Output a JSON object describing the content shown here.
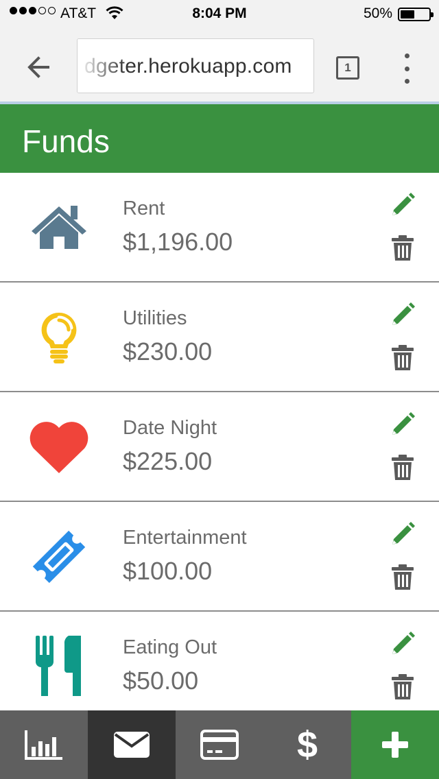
{
  "status_bar": {
    "carrier": "AT&T",
    "time": "8:04 PM",
    "battery_percent": "50%",
    "battery_level": 0.5,
    "signal_bars_filled": 3,
    "signal_bars_total": 5
  },
  "browser": {
    "url": "dgeter.herokuapp.com",
    "tab_count": "1"
  },
  "header": {
    "title": "Funds",
    "color": "#3a9140"
  },
  "funds": [
    {
      "name": "Rent",
      "amount": "$1,196.00",
      "icon": "house-icon",
      "icon_color": "#5a7a8f"
    },
    {
      "name": "Utilities",
      "amount": "$230.00",
      "icon": "lightbulb-icon",
      "icon_color": "#f5c218"
    },
    {
      "name": "Date Night",
      "amount": "$225.00",
      "icon": "heart-icon",
      "icon_color": "#f0443a"
    },
    {
      "name": "Entertainment",
      "amount": "$100.00",
      "icon": "ticket-icon",
      "icon_color": "#2a8ee8"
    },
    {
      "name": "Eating Out",
      "amount": "$50.00",
      "icon": "fork-knife-icon",
      "icon_color": "#0f9988"
    }
  ],
  "actions": {
    "edit_color": "#3a9140",
    "delete_color": "#5a5a5a"
  },
  "bottom_nav": [
    {
      "icon": "bar-chart-icon",
      "active": false
    },
    {
      "icon": "envelope-icon",
      "active": true
    },
    {
      "icon": "credit-card-icon",
      "active": false
    },
    {
      "icon": "dollar-icon",
      "label": "$",
      "active": false
    },
    {
      "icon": "plus-icon",
      "active": false
    }
  ]
}
